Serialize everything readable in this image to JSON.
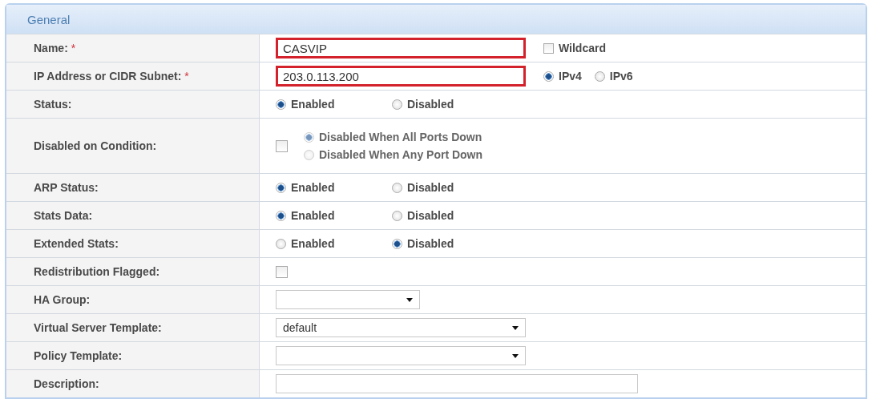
{
  "section": {
    "title": "General"
  },
  "rows": [
    {
      "kind": "text",
      "label": "Name:",
      "required_mark": "*",
      "value": "CASVIP",
      "invalid": true,
      "extra": {
        "kind": "checkbox",
        "label": "Wildcard",
        "checked": false
      }
    },
    {
      "kind": "text",
      "label": "IP Address or CIDR Subnet:",
      "required_mark": "*",
      "value": "203.0.113.200",
      "invalid": true,
      "extra": {
        "kind": "radios",
        "options": [
          {
            "label": "IPv4",
            "selected": true
          },
          {
            "label": "IPv6",
            "selected": false
          }
        ]
      }
    },
    {
      "kind": "radios",
      "label": "Status:",
      "options": [
        {
          "label": "Enabled",
          "selected": true
        },
        {
          "label": "Disabled",
          "selected": false
        }
      ]
    },
    {
      "kind": "condition",
      "label": "Disabled on Condition:",
      "checked": false,
      "options": [
        {
          "label": "Disabled When All Ports Down",
          "selected": true,
          "disabled": true
        },
        {
          "label": "Disabled When Any Port Down",
          "selected": false,
          "disabled": true
        }
      ]
    },
    {
      "kind": "radios",
      "label": "ARP Status:",
      "options": [
        {
          "label": "Enabled",
          "selected": true
        },
        {
          "label": "Disabled",
          "selected": false
        }
      ]
    },
    {
      "kind": "radios",
      "label": "Stats Data:",
      "options": [
        {
          "label": "Enabled",
          "selected": true
        },
        {
          "label": "Disabled",
          "selected": false
        }
      ]
    },
    {
      "kind": "radios",
      "label": "Extended Stats:",
      "options": [
        {
          "label": "Enabled",
          "selected": false
        },
        {
          "label": "Disabled",
          "selected": true
        }
      ]
    },
    {
      "kind": "checkbox",
      "label": "Redistribution Flagged:",
      "checked": false
    },
    {
      "kind": "short-select",
      "label": "HA Group:"
    },
    {
      "kind": "select",
      "label": "Virtual Server Template:",
      "value": "default"
    },
    {
      "kind": "select",
      "label": "Policy Template:"
    },
    {
      "kind": "input",
      "label": "Description:"
    }
  ]
}
